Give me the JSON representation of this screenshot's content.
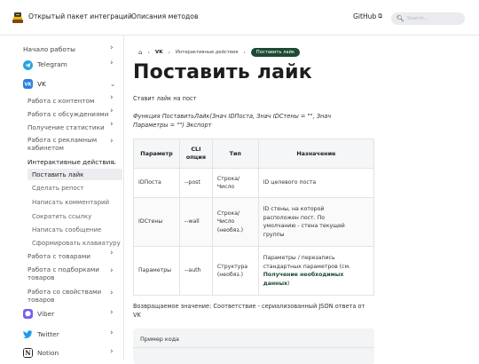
{
  "header": {
    "site_title": "Открытый пакет интеграций",
    "methods_link": "Описания методов",
    "github_label": "GitHub",
    "search_placeholder": "Search..."
  },
  "sidebar": {
    "start": "Начало работы",
    "telegram": "Telegram",
    "vk": "VK",
    "vk_items": [
      "Работа с контентом",
      "Работа с обсуждениями",
      "Получение статистики"
    ],
    "ads_line1": "Работа с рекламным",
    "ads_line2": "кабинетом",
    "interactive": "Интерактивные действия",
    "interactive_items": [
      "Поставить лайк",
      "Сделать репост",
      "Написать комментарий",
      "Сократить ссылку",
      "Написать сообщение",
      "Сформировать клавиатуру"
    ],
    "goods": "Работа с товарами",
    "collections_line1": "Работа с подборками",
    "collections_line2": "товаров",
    "props_line1": "Работа со свойствами",
    "props_line2": "товаров",
    "viber": "Viber",
    "twitter": "Twitter",
    "notion": "Notion"
  },
  "breadcrumbs": {
    "vk": "VK",
    "section": "Интерактивные действия",
    "current": "Поставить лайк"
  },
  "page": {
    "title": "Поставить лайк",
    "description": "Ставит лайк на пост",
    "signature_line1": "Функция ПоставитьЛайк(Знач IDПоста, Знач IDСтены = \"\", Знач",
    "signature_line2": "Параметры = \"\") Экспорт"
  },
  "params_table": {
    "headers": {
      "param": "Параметр",
      "cli_line1": "CLI",
      "cli_line2": "опция",
      "type": "Тип",
      "purpose": "Назначение"
    },
    "rows": [
      {
        "param": "IDПоста",
        "cli": "--post",
        "type_lines": [
          "Строка/",
          "Число"
        ],
        "purpose_lines": [
          "ID целевого поста"
        ]
      },
      {
        "param": "IDСтены",
        "cli": "--wall",
        "type_lines": [
          "Строка/",
          "Число",
          "(необяз.)"
        ],
        "purpose_lines": [
          "ID стены, на которой",
          "расположен пост. По",
          "умолчанию - стена текущей",
          "группы"
        ]
      },
      {
        "param": "Параметры",
        "cli": "--auth",
        "type_lines": [
          "Структура",
          "(необяз.)"
        ],
        "purpose_lines": [
          "Параметры / перезапись",
          "стандартных параметров (см."
        ],
        "purpose_link_line1": "Получение необходимых",
        "purpose_link_line2": "данных",
        "purpose_tail": ")"
      }
    ]
  },
  "returns": {
    "line1": "Возвращаемое значение: Соответствие - сериализованный JSON ответа от",
    "line2": "VK"
  },
  "code_example": {
    "title": "Пример кода"
  },
  "colors": {
    "accent": "#1c4a33",
    "telegram": "#2aa3e0",
    "vk": "#2b7fe0",
    "viber": "#7360f2",
    "twitter": "#1d9bf0",
    "notion": "#ffffff"
  }
}
